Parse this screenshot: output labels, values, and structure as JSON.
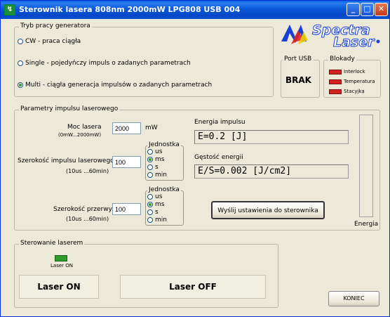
{
  "window": {
    "title": "Sterownik lasera 808nm 2000mW LPG808 USB 004"
  },
  "mode": {
    "title": "Tryb pracy generatora",
    "options": [
      {
        "label": "CW - praca ciągła",
        "selected": false
      },
      {
        "label": "Single - pojedyńczy impuls o zadanych parametrach",
        "selected": false
      },
      {
        "label": "Multi - ciągła generacja impulsów o zadanych parametrach",
        "selected": true
      }
    ]
  },
  "logo": {
    "line1": "Spectra",
    "line2": "Laser"
  },
  "usb": {
    "title": "Port USB",
    "status": "BRAK"
  },
  "locks": {
    "title": "Blokady",
    "items": [
      "Interlock",
      "Temperatura",
      "Stacyjka"
    ]
  },
  "params": {
    "title": "Parametry impulsu laserowego",
    "power": {
      "label": "Moc lasera",
      "range": "(0mW...2000mW)",
      "value": "2000",
      "unit": "mW"
    },
    "pulse": {
      "label": "Szerokość impulsu laserowego",
      "range": "(10us ...60min)",
      "value": "100"
    },
    "gap": {
      "label": "Szerokość przerwy",
      "range": "(10us ...60min)",
      "value": "100"
    },
    "unit_group_title": "Jednostka",
    "pulse_units": [
      {
        "label": "us",
        "selected": false
      },
      {
        "label": "ms",
        "selected": true
      },
      {
        "label": "s",
        "selected": false
      },
      {
        "label": "min",
        "selected": false
      }
    ],
    "gap_units": [
      {
        "label": "us",
        "selected": false
      },
      {
        "label": "ms",
        "selected": true
      },
      {
        "label": "s",
        "selected": false
      },
      {
        "label": "min",
        "selected": false
      }
    ],
    "energy_title": "Energia impulsu",
    "energy_value": "E=0.2 [J]",
    "density_title": "Gęstość energii",
    "density_value": "E/S=0.002 [J/cm2]",
    "send_button": "Wyślij ustawienia do sterownika",
    "energy_bar_label": "Energia",
    "energy_bar_fill": 0
  },
  "control": {
    "title": "Sterowanie laserem",
    "indicator_label": "Laser ON",
    "on_button": "Laser ON",
    "off_button": "Laser OFF"
  },
  "exit_button": "KONIEC"
}
